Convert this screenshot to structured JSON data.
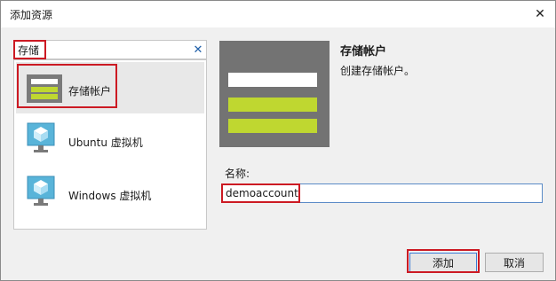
{
  "window": {
    "title": "添加资源",
    "close_glyph": "✕"
  },
  "search": {
    "value": "存储",
    "clear_glyph": "✕"
  },
  "items": [
    {
      "label": "存储帐户",
      "icon": "storage-account-icon",
      "selected": true
    },
    {
      "label": "Ubuntu 虚拟机",
      "icon": "virtual-machine-icon",
      "selected": false
    },
    {
      "label": "Windows 虚拟机",
      "icon": "virtual-machine-icon",
      "selected": false
    }
  ],
  "detail": {
    "title": "存储帐户",
    "description": "创建存储帐户。"
  },
  "form": {
    "name_label": "名称:",
    "name_value": "demoaccount"
  },
  "buttons": {
    "add": "添加",
    "cancel": "取消"
  },
  "colors": {
    "highlight": "#cc1a23",
    "storage_gray": "#737373",
    "storage_green": "#bfd730",
    "vm_blue": "#59b4d9"
  }
}
